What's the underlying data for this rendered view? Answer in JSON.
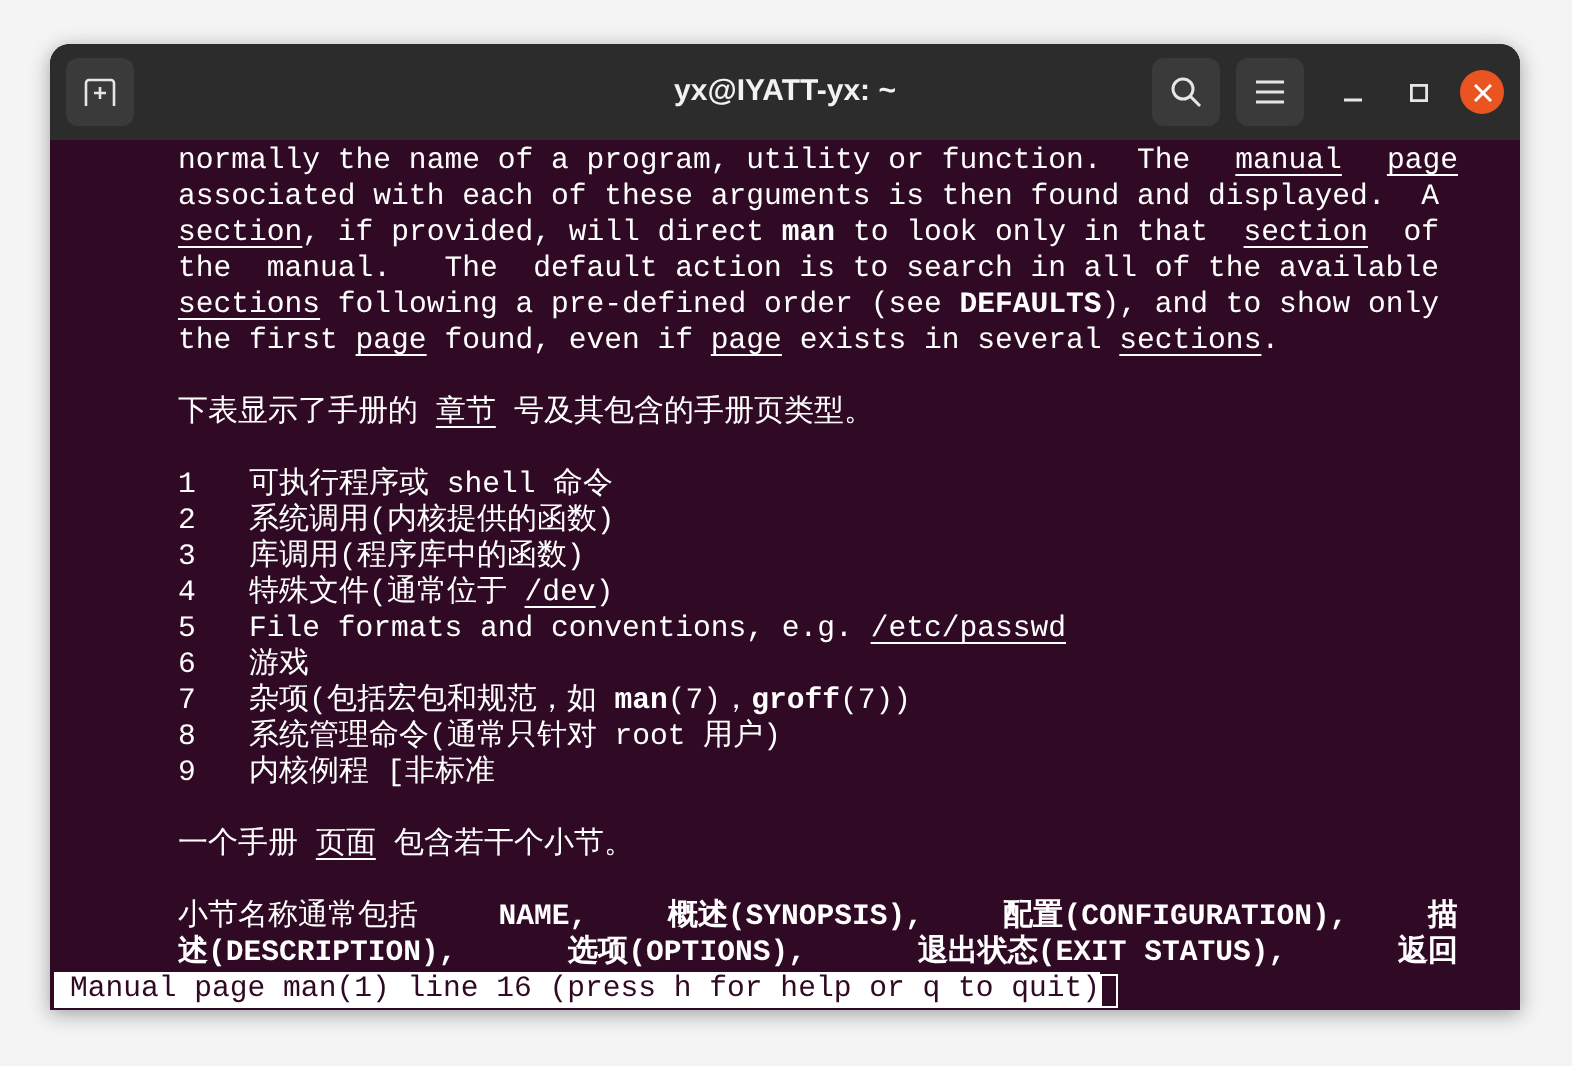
{
  "window": {
    "title": "yx@IYATT-yx: ~"
  },
  "terminal": {
    "lines": [
      {
        "kind": "justified",
        "segments": [
          {
            "kind": "plain",
            "text": "normally the name of a program, utility or function.  The"
          },
          {
            "kind": "underline",
            "text": "manual"
          },
          {
            "kind": "underline",
            "text": "page"
          }
        ]
      },
      {
        "kind": "text",
        "segments": [
          {
            "kind": "plain",
            "text": "associated with each of these arguments is then found and displayed.  A"
          }
        ]
      },
      {
        "kind": "text",
        "segments": [
          {
            "kind": "underline",
            "text": "section"
          },
          {
            "kind": "plain",
            "text": ", if provided, will direct "
          },
          {
            "kind": "bold",
            "text": "man"
          },
          {
            "kind": "plain",
            "text": " to look only in that  "
          },
          {
            "kind": "underline",
            "text": "section"
          },
          {
            "kind": "plain",
            "text": "  of"
          }
        ]
      },
      {
        "kind": "text",
        "segments": [
          {
            "kind": "plain",
            "text": "the  manual.   The  default action is to search in all of the available"
          }
        ]
      },
      {
        "kind": "text",
        "segments": [
          {
            "kind": "underline",
            "text": "sections"
          },
          {
            "kind": "plain",
            "text": " following a pre-defined order (see "
          },
          {
            "kind": "bold",
            "text": "DEFAULTS"
          },
          {
            "kind": "plain",
            "text": "), and to show only"
          }
        ]
      },
      {
        "kind": "text",
        "segments": [
          {
            "kind": "plain",
            "text": "the first "
          },
          {
            "kind": "underline",
            "text": "page"
          },
          {
            "kind": "plain",
            "text": " found, even if "
          },
          {
            "kind": "underline",
            "text": "page"
          },
          {
            "kind": "plain",
            "text": " exists in several "
          },
          {
            "kind": "underline",
            "text": "sections"
          },
          {
            "kind": "plain",
            "text": "."
          }
        ]
      },
      {
        "kind": "blank"
      },
      {
        "kind": "text",
        "segments": [
          {
            "kind": "plain",
            "text": "下表显示了手册的 "
          },
          {
            "kind": "underline",
            "text": "章节"
          },
          {
            "kind": "plain",
            "text": " 号及其包含的手册页类型。"
          }
        ]
      },
      {
        "kind": "blank"
      },
      {
        "kind": "text",
        "segments": [
          {
            "kind": "plain",
            "text": "1   可执行程序或 shell 命令"
          }
        ]
      },
      {
        "kind": "text",
        "segments": [
          {
            "kind": "plain",
            "text": "2   系统调用(内核提供的函数)"
          }
        ]
      },
      {
        "kind": "text",
        "segments": [
          {
            "kind": "plain",
            "text": "3   库调用(程序库中的函数)"
          }
        ]
      },
      {
        "kind": "text",
        "segments": [
          {
            "kind": "plain",
            "text": "4   特殊文件(通常位于 "
          },
          {
            "kind": "underline",
            "text": "/dev"
          },
          {
            "kind": "plain",
            "text": ")"
          }
        ]
      },
      {
        "kind": "text",
        "segments": [
          {
            "kind": "plain",
            "text": "5   File formats and conventions, e.g. "
          },
          {
            "kind": "underline",
            "text": "/etc/passwd"
          }
        ]
      },
      {
        "kind": "text",
        "segments": [
          {
            "kind": "plain",
            "text": "6   游戏"
          }
        ]
      },
      {
        "kind": "text",
        "segments": [
          {
            "kind": "plain",
            "text": "7   杂项(包括宏包和规范，如 "
          },
          {
            "kind": "bold",
            "text": "man"
          },
          {
            "kind": "plain",
            "text": "(7)，"
          },
          {
            "kind": "bold",
            "text": "groff"
          },
          {
            "kind": "plain",
            "text": "(7))"
          }
        ]
      },
      {
        "kind": "text",
        "segments": [
          {
            "kind": "plain",
            "text": "8   系统管理命令(通常只针对 root 用户)"
          }
        ]
      },
      {
        "kind": "text",
        "segments": [
          {
            "kind": "plain",
            "text": "9   内核例程 [非标准"
          }
        ]
      },
      {
        "kind": "blank"
      },
      {
        "kind": "text",
        "segments": [
          {
            "kind": "plain",
            "text": "一个手册 "
          },
          {
            "kind": "underline",
            "text": "页面"
          },
          {
            "kind": "plain",
            "text": " 包含若干个小节。"
          }
        ]
      },
      {
        "kind": "blank"
      },
      {
        "kind": "justified",
        "segments": [
          {
            "kind": "plain",
            "text": "小节名称通常包括"
          },
          {
            "kind": "bold",
            "text": "NAME,"
          },
          {
            "kind": "bold",
            "text": "概述(SYNOPSIS),"
          },
          {
            "kind": "bold",
            "text": "配置(CONFIGURATION),"
          },
          {
            "kind": "bold",
            "text": "描"
          }
        ]
      },
      {
        "kind": "justified",
        "segments": [
          {
            "kind": "bold",
            "text": "述(DESCRIPTION),"
          },
          {
            "kind": "bold",
            "text": "选项(OPTIONS),"
          },
          {
            "kind": "bold",
            "text": "退出状态(EXIT STATUS),"
          },
          {
            "kind": "bold",
            "text": "返回"
          }
        ]
      }
    ],
    "status_line": "Manual page man(1) line 16 (press h for help or q to quit)"
  }
}
